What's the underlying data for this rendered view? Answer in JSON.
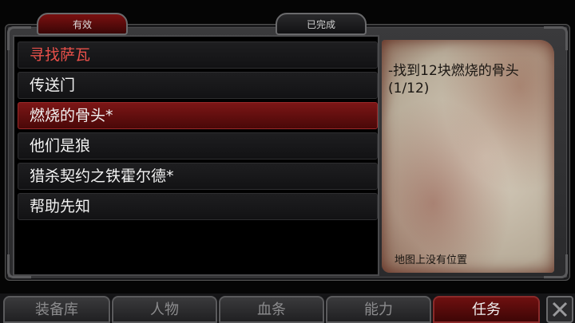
{
  "tabs": {
    "active_label": "有效",
    "completed_label": "已完成"
  },
  "quests": [
    {
      "label": "寻找萨瓦",
      "kind": "title"
    },
    {
      "label": "传送门",
      "kind": "normal"
    },
    {
      "label": "燃烧的骨头*",
      "kind": "selected"
    },
    {
      "label": "他们是狼",
      "kind": "normal"
    },
    {
      "label": "猎杀契约之铁霍尔德*",
      "kind": "normal"
    },
    {
      "label": "帮助先知",
      "kind": "normal"
    }
  ],
  "detail": {
    "objective": "-找到12块燃烧的骨头 (1/12)",
    "map_note": "地图上没有位置"
  },
  "nav": [
    {
      "label": "装备库",
      "active": false
    },
    {
      "label": "人物",
      "active": false
    },
    {
      "label": "血条",
      "active": false
    },
    {
      "label": "能力",
      "active": false
    },
    {
      "label": "任务",
      "active": true
    }
  ],
  "close_icon": "close-x-icon",
  "colors": {
    "accent_red": "#7c1616",
    "title_red": "#e8504a",
    "parchment": "#d8cfbf"
  }
}
